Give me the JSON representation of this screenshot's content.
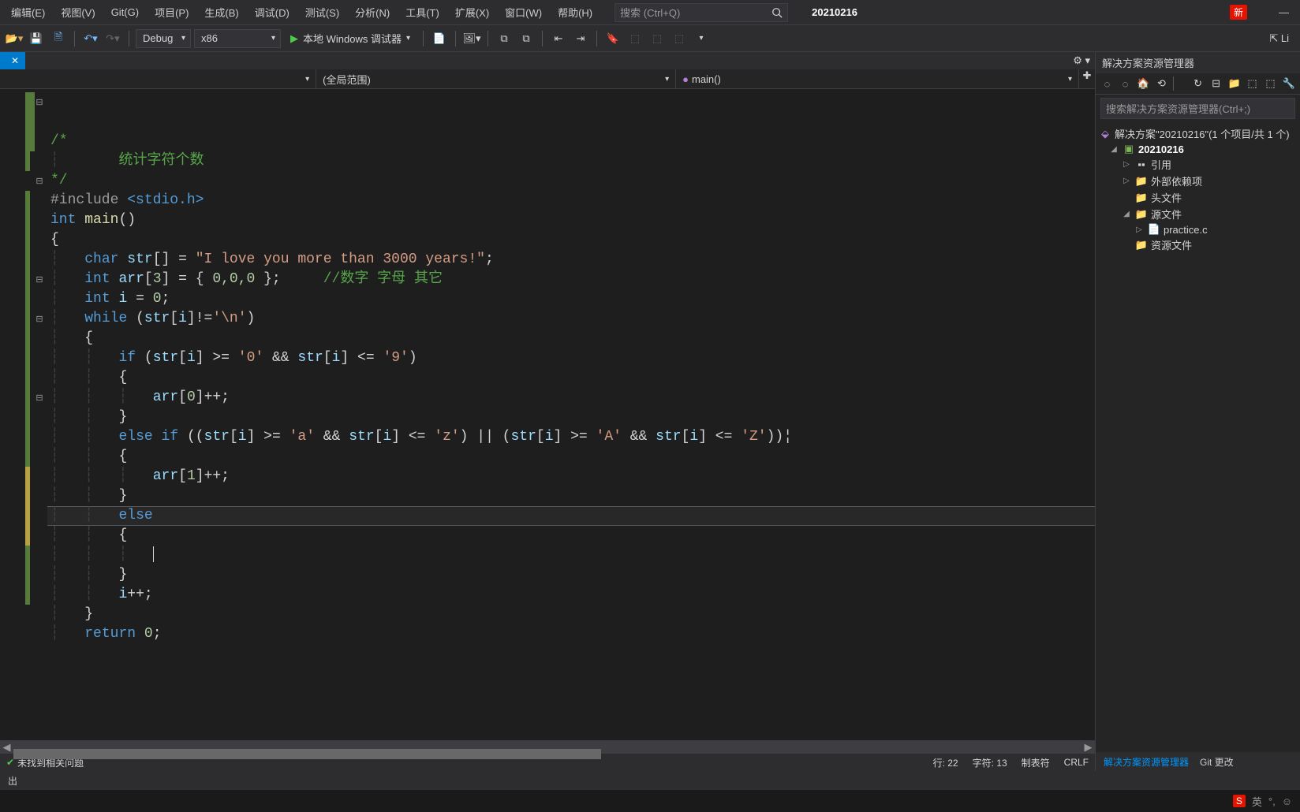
{
  "menu": {
    "items": [
      "编辑(E)",
      "视图(V)",
      "Git(G)",
      "项目(P)",
      "生成(B)",
      "调试(D)",
      "测试(S)",
      "分析(N)",
      "工具(T)",
      "扩展(X)",
      "窗口(W)",
      "帮助(H)"
    ],
    "search_placeholder": "搜索 (Ctrl+Q)",
    "project_name": "20210216",
    "new_badge": "新"
  },
  "toolbar": {
    "config": "Debug",
    "platform": "x86",
    "debugger": "本地 Windows 调试器",
    "live_share": "Li"
  },
  "tab": {
    "label": "",
    "close": "✕"
  },
  "navbar": {
    "scope": "(全局范围)",
    "func": "main()"
  },
  "code": {
    "comment1": "/*",
    "comment2": "    统计字符个数",
    "comment3": "*/",
    "include": "#include ",
    "include_file": "<stdio.h>",
    "int_kw": "int",
    "main_fn": "main",
    "char_kw": "char",
    "str_id": "str",
    "str_lit": "\"I love you more than 3000 years!\"",
    "arr_id": "arr",
    "arr_size": "3",
    "arr_init": "0,0,0",
    "arr_comment": "//数字 字母 其它",
    "i_id": "i",
    "zero": "0",
    "while_kw": "while",
    "newline_chr": "'\\n'",
    "if_kw": "if",
    "chr0": "'0'",
    "chr9": "'9'",
    "chra": "'a'",
    "chrz": "'z'",
    "chrA": "'A'",
    "chrZ": "'Z'",
    "else_kw": "else",
    "return_kw": "return",
    "idx0": "0",
    "idx1": "1"
  },
  "statusbar": {
    "issues": "未找到相关问题",
    "line": "行: 22",
    "char": "字符: 13",
    "tabs": "制表符",
    "encoding": "CRLF",
    "sol_explorer": "解决方案资源管理器",
    "git_changes": "Git 更改"
  },
  "solution": {
    "title": "解决方案资源管理器",
    "search_placeholder": "搜索解决方案资源管理器(Ctrl+;)",
    "root": "解决方案\"20210216\"(1 个项目/共 1 个)",
    "project": "20210216",
    "refs": "引用",
    "ext_deps": "外部依赖项",
    "headers": "头文件",
    "sources": "源文件",
    "practice": "practice.c",
    "resources": "资源文件"
  },
  "bottom": {
    "output_label": "出"
  },
  "taskbar": {
    "ime": "S",
    "lang": "英"
  }
}
